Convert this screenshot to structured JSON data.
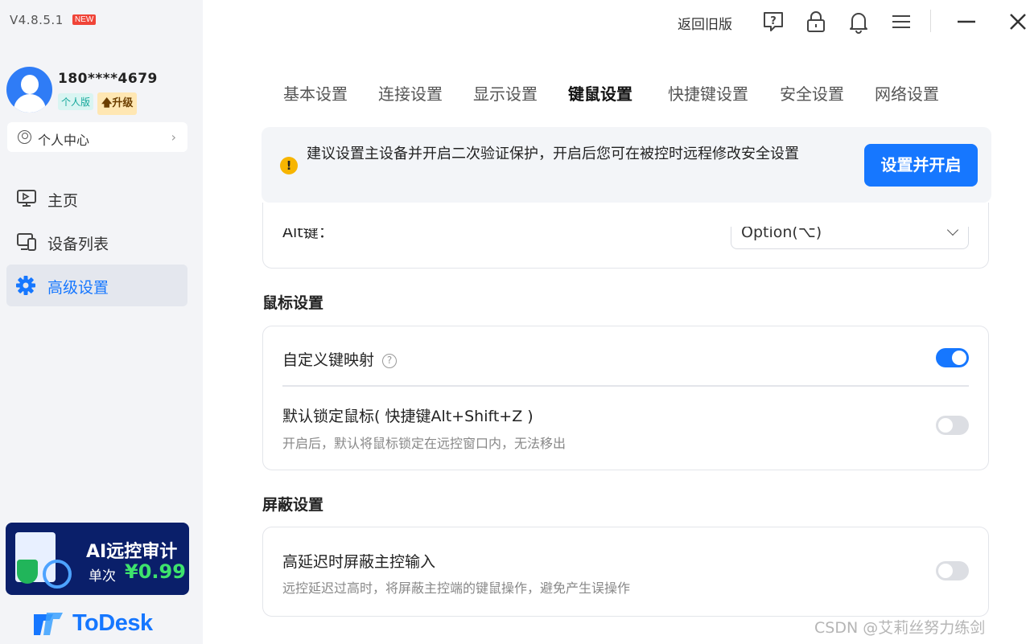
{
  "app": {
    "version": "V4.8.5.1",
    "new_badge": "NEW",
    "brand_name": "ToDesk"
  },
  "user": {
    "phone": "180****4679",
    "tier": "个人版",
    "upgrade": "🡅升级",
    "personal_center": "个人中心"
  },
  "sidebar": {
    "items": [
      {
        "label": "主页",
        "icon": "monitor-icon",
        "active": false
      },
      {
        "label": "设备列表",
        "icon": "devices-icon",
        "active": false
      },
      {
        "label": "高级设置",
        "icon": "gear-icon",
        "active": true
      }
    ]
  },
  "promo": {
    "title": "AI远控审计",
    "price_label": "单次",
    "price": "¥0.99"
  },
  "topbar": {
    "back_old": "返回旧版",
    "icons": [
      "help-icon",
      "lock-icon",
      "bell-icon",
      "menu-icon",
      "minimize-icon",
      "close-icon"
    ]
  },
  "tabs": [
    {
      "label": "基本设置",
      "active": false
    },
    {
      "label": "连接设置",
      "active": false
    },
    {
      "label": "显示设置",
      "active": false
    },
    {
      "label": "键鼠设置",
      "active": true
    },
    {
      "label": "快捷键设置",
      "active": false
    },
    {
      "label": "安全设置",
      "active": false
    },
    {
      "label": "网络设置",
      "active": false
    }
  ],
  "alert": {
    "text": "建议设置主设备并开启二次验证保护，开启后您可在被控时远程修改安全设置",
    "button": "设置并开启"
  },
  "keyboard": {
    "alt_label": "Alt键：",
    "alt_value": "Option(⌥)"
  },
  "mouse_section": {
    "title": "鼠标设置",
    "rows": [
      {
        "label": "自定义键映射",
        "help": "?",
        "enabled": true
      },
      {
        "label": "默认锁定鼠标( 快捷键Alt+Shift+Z )",
        "desc": "开启后，默认将鼠标锁定在远控窗口内，无法移出",
        "enabled": false
      }
    ]
  },
  "block_section": {
    "title": "屏蔽设置",
    "rows": [
      {
        "label": "高延迟时屏蔽主控输入",
        "desc": "远控延迟过高时，将屏蔽主控端的键鼠操作，避免产生误操作",
        "enabled": false
      }
    ]
  },
  "watermark": "CSDN @艾莉丝努力练剑",
  "colors": {
    "accent": "#1677ff",
    "sidebar_bg": "#f3f4f7",
    "promo_bg": "#0a1f6a",
    "promo_price": "#3ee36c",
    "warning": "#f7b500"
  }
}
